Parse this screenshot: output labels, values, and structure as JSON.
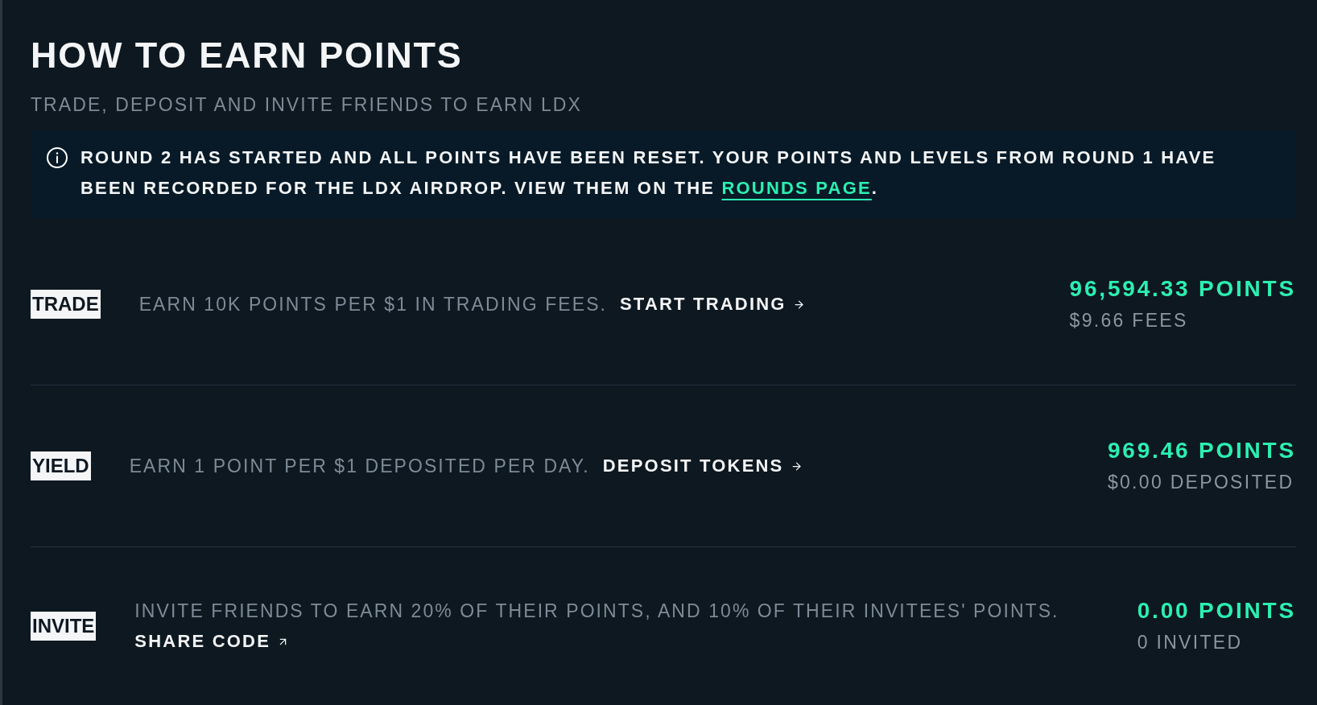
{
  "header": {
    "title": "HOW TO EARN POINTS",
    "subtitle": "TRADE, DEPOSIT AND INVITE FRIENDS TO EARN LDX"
  },
  "notice": {
    "text_before": "ROUND 2 HAS STARTED AND ALL POINTS HAVE BEEN RESET. YOUR POINTS AND LEVELS FROM ROUND 1 HAVE BEEN RECORDED FOR THE LDX AIRDROP. VIEW THEM ON THE ",
    "link": "ROUNDS PAGE",
    "text_after": "."
  },
  "rows": [
    {
      "tag": "TRADE",
      "description": "EARN 10K POINTS PER $1 IN TRADING FEES.",
      "action": {
        "label": "START TRADING",
        "kind": "internal"
      },
      "points": "96,594.33 POINTS",
      "detail": "$9.66 FEES"
    },
    {
      "tag": "YIELD",
      "description": "EARN 1 POINT PER $1 DEPOSITED PER DAY.",
      "action": {
        "label": "DEPOSIT TOKENS",
        "kind": "internal"
      },
      "points": "969.46 POINTS",
      "detail": "$0.00 DEPOSITED"
    },
    {
      "tag": "INVITE",
      "description": "INVITE FRIENDS TO EARN 20% OF THEIR POINTS, AND 10% OF THEIR INVITEES' POINTS.",
      "action": {
        "label": "SHARE CODE",
        "kind": "external"
      },
      "points": "0.00 POINTS",
      "detail": "0 INVITED"
    }
  ]
}
